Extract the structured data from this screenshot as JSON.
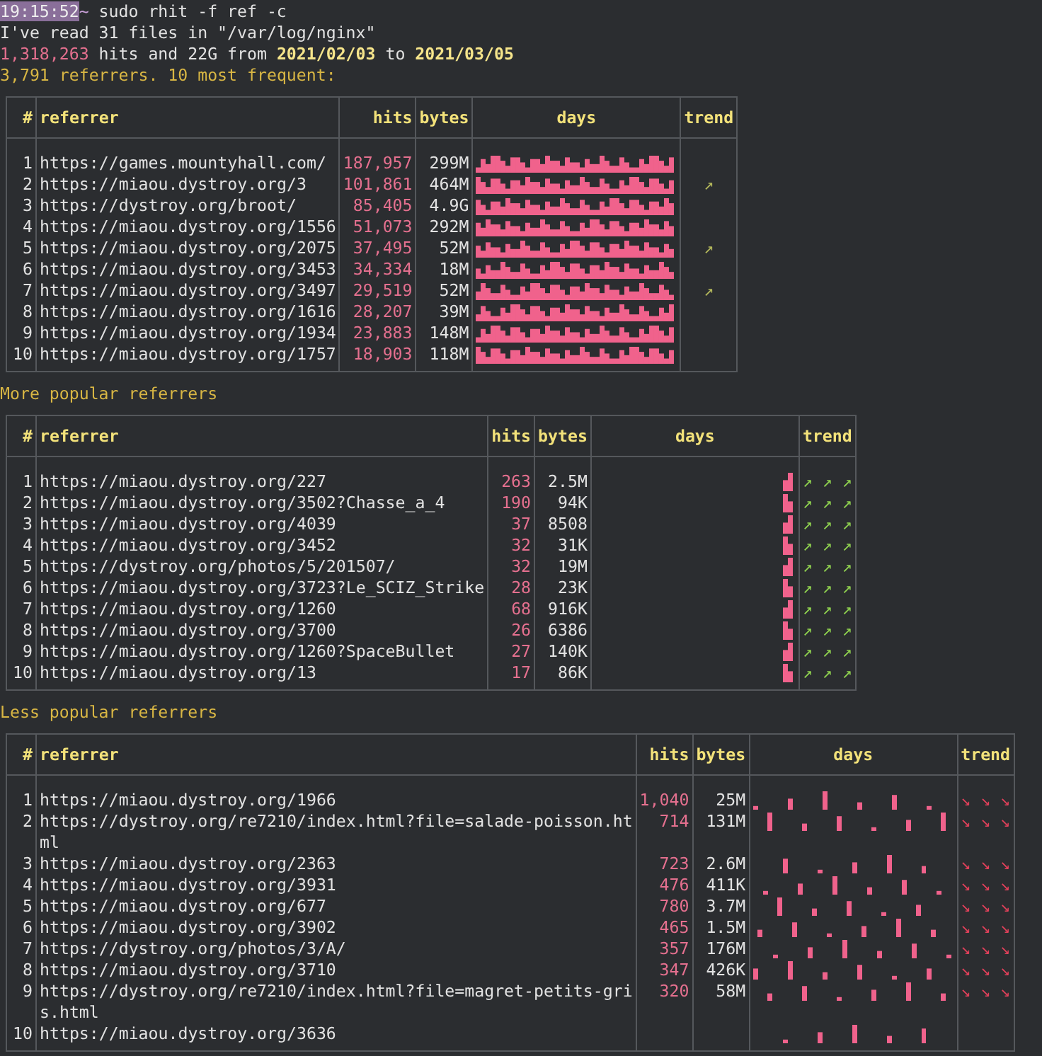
{
  "prompt": {
    "time": "19:15:52",
    "cwd": "~",
    "command": "sudo rhit -f ref -c"
  },
  "summary": {
    "files_line": "I've read 31 files in \"/var/log/nginx\"",
    "hits": "1,318,263",
    "middle": "hits and 22G from",
    "start": "2021/02/03",
    "to": "to",
    "end": "2021/03/05"
  },
  "sections": [
    {
      "title": "3,791 referrers. 10 most frequent:",
      "columns": [
        "#",
        "referrer",
        "hits",
        "bytes",
        "days",
        "trend"
      ],
      "rows": [
        {
          "n": "1",
          "referrer": "https://games.mountyhall.com/",
          "hits": "187,957",
          "bytes": "299M"
        },
        {
          "n": "2",
          "referrer": "https://miaou.dystroy.org/3",
          "hits": "101,861",
          "bytes": "464M",
          "trend": "↗",
          "color": "#b4b85c"
        },
        {
          "n": "3",
          "referrer": "https://dystroy.org/broot/",
          "hits": "85,405",
          "bytes": "4.9G"
        },
        {
          "n": "4",
          "referrer": "https://miaou.dystroy.org/1556",
          "hits": "51,073",
          "bytes": "292M"
        },
        {
          "n": "5",
          "referrer": "https://miaou.dystroy.org/2075",
          "hits": "37,495",
          "bytes": "52M",
          "trend": "↗",
          "color": "#b4b85c"
        },
        {
          "n": "6",
          "referrer": "https://miaou.dystroy.org/3453",
          "hits": "34,334",
          "bytes": "18M"
        },
        {
          "n": "7",
          "referrer": "https://miaou.dystroy.org/3497",
          "hits": "29,519",
          "bytes": "52M",
          "trend": "↗",
          "color": "#b4b85c"
        },
        {
          "n": "8",
          "referrer": "https://miaou.dystroy.org/1616",
          "hits": "28,207",
          "bytes": "39M"
        },
        {
          "n": "9",
          "referrer": "https://miaou.dystroy.org/1934",
          "hits": "23,883",
          "bytes": "148M"
        },
        {
          "n": "10",
          "referrer": "https://miaou.dystroy.org/1757",
          "hits": "18,903",
          "bytes": "118M"
        }
      ]
    },
    {
      "title": "More popular referrers",
      "columns": [
        "#",
        "referrer",
        "hits",
        "bytes",
        "days",
        "trend"
      ],
      "rows": [
        {
          "n": "1",
          "referrer": "https://miaou.dystroy.org/227",
          "hits": "263",
          "bytes": "2.5M",
          "trend": "↗ ↗ ↗",
          "color": "#8fd14f"
        },
        {
          "n": "2",
          "referrer": "https://miaou.dystroy.org/3502?Chasse_a_4",
          "hits": "190",
          "bytes": "94K",
          "trend": "↗ ↗ ↗",
          "color": "#8fd14f"
        },
        {
          "n": "3",
          "referrer": "https://miaou.dystroy.org/4039",
          "hits": "37",
          "bytes": "8508",
          "trend": "↗ ↗ ↗",
          "color": "#8fd14f"
        },
        {
          "n": "4",
          "referrer": "https://miaou.dystroy.org/3452",
          "hits": "32",
          "bytes": "31K",
          "trend": "↗ ↗ ↗",
          "color": "#8fd14f"
        },
        {
          "n": "5",
          "referrer": "https://dystroy.org/photos/5/201507/",
          "hits": "32",
          "bytes": "19M",
          "trend": "↗ ↗ ↗",
          "color": "#8fd14f"
        },
        {
          "n": "6",
          "referrer": "https://miaou.dystroy.org/3723?Le_SCIZ_Strike",
          "hits": "28",
          "bytes": "23K",
          "trend": "↗ ↗ ↗",
          "color": "#8fd14f"
        },
        {
          "n": "7",
          "referrer": "https://miaou.dystroy.org/1260",
          "hits": "68",
          "bytes": "916K",
          "trend": "↗ ↗ ↗",
          "color": "#8fd14f"
        },
        {
          "n": "8",
          "referrer": "https://miaou.dystroy.org/3700",
          "hits": "26",
          "bytes": "6386",
          "trend": "↗ ↗ ↗",
          "color": "#8fd14f"
        },
        {
          "n": "9",
          "referrer": "https://miaou.dystroy.org/1260?SpaceBullet",
          "hits": "27",
          "bytes": "140K",
          "trend": "↗ ↗ ↗",
          "color": "#8fd14f"
        },
        {
          "n": "10",
          "referrer": "https://miaou.dystroy.org/13",
          "hits": "17",
          "bytes": "86K",
          "trend": "↗ ↗ ↗",
          "color": "#8fd14f"
        }
      ]
    },
    {
      "title": "Less popular referrers",
      "columns": [
        "#",
        "referrer",
        "hits",
        "bytes",
        "days",
        "trend"
      ],
      "rows": [
        {
          "n": "1",
          "referrer": "https://miaou.dystroy.org/1966",
          "hits": "1,040",
          "bytes": "25M",
          "trend": "↘ ↘ ↘",
          "color": "#e0405a"
        },
        {
          "n": "2",
          "referrer": "https://dystroy.org/re7210/index.html?file=salade-poisson.html",
          "hits": "714",
          "bytes": "131M",
          "trend": "↘ ↘ ↘",
          "color": "#e0405a"
        },
        {
          "n": "3",
          "referrer": "https://miaou.dystroy.org/2363",
          "hits": "723",
          "bytes": "2.6M",
          "trend": "↘ ↘ ↘",
          "color": "#e0405a"
        },
        {
          "n": "4",
          "referrer": "https://miaou.dystroy.org/3931",
          "hits": "476",
          "bytes": "411K",
          "trend": "↘ ↘ ↘",
          "color": "#e0405a"
        },
        {
          "n": "5",
          "referrer": "https://miaou.dystroy.org/677",
          "hits": "780",
          "bytes": "3.7M",
          "trend": "↘ ↘ ↘",
          "color": "#e0405a"
        },
        {
          "n": "6",
          "referrer": "https://miaou.dystroy.org/3902",
          "hits": "465",
          "bytes": "1.5M",
          "trend": "↘ ↘ ↘",
          "color": "#e0405a"
        },
        {
          "n": "7",
          "referrer": "https://dystroy.org/photos/3/A/",
          "hits": "357",
          "bytes": "176M",
          "trend": "↘ ↘ ↘",
          "color": "#e0405a"
        },
        {
          "n": "8",
          "referrer": "https://miaou.dystroy.org/3710",
          "hits": "347",
          "bytes": "426K",
          "trend": "↘ ↘ ↘",
          "color": "#e0405a"
        },
        {
          "n": "9",
          "referrer": "https://dystroy.org/re7210/index.html?file=magret-petits-gris.html",
          "hits": "320",
          "bytes": "58M",
          "trend": "↘ ↘ ↘",
          "color": "#e0405a"
        },
        {
          "n": "10",
          "referrer": "https://miaou.dystroy.org/3636"
        }
      ]
    }
  ]
}
